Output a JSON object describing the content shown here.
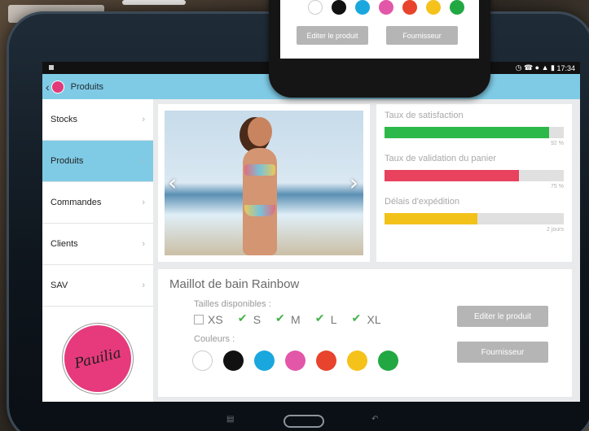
{
  "status": {
    "time": "17:34"
  },
  "appbar": {
    "title": "Produits"
  },
  "sidebar": {
    "items": [
      {
        "label": "Stocks"
      },
      {
        "label": "Produits"
      },
      {
        "label": "Commandes"
      },
      {
        "label": "Clients"
      },
      {
        "label": "SAV"
      }
    ],
    "active_index": 1,
    "logo_text": "Pauilia"
  },
  "stats": [
    {
      "label": "Taux de satisfaction",
      "value": "92 %",
      "fill_percent": 92,
      "color": "#2db84a"
    },
    {
      "label": "Taux de validation du panier",
      "value": "75 %",
      "fill_percent": 75,
      "color": "#e8425e"
    },
    {
      "label": "Délais d'expédition",
      "value": "2 jours",
      "fill_percent": 52,
      "color": "#f2c21b"
    }
  ],
  "product": {
    "title": "Maillot de bain Rainbow",
    "sizes_label": "Tailles disponibles :",
    "sizes": [
      {
        "label": "XS",
        "checked": false
      },
      {
        "label": "S",
        "checked": true
      },
      {
        "label": "M",
        "checked": true
      },
      {
        "label": "L",
        "checked": true
      },
      {
        "label": "XL",
        "checked": true
      }
    ],
    "colors_label": "Couleurs :",
    "colors": [
      "#ffffff",
      "#111111",
      "#1aa7de",
      "#e257a8",
      "#e8432c",
      "#f5c21b",
      "#22a843"
    ],
    "edit_button": "Editer le produit",
    "supplier_button": "Fournisseur"
  },
  "phone": {
    "colors": [
      "#ffffff",
      "#111111",
      "#1aa7de",
      "#e257a8",
      "#e8432c",
      "#f5c21b",
      "#22a843"
    ],
    "edit_button": "Editer le produit",
    "supplier_button": "Fournisseur"
  }
}
